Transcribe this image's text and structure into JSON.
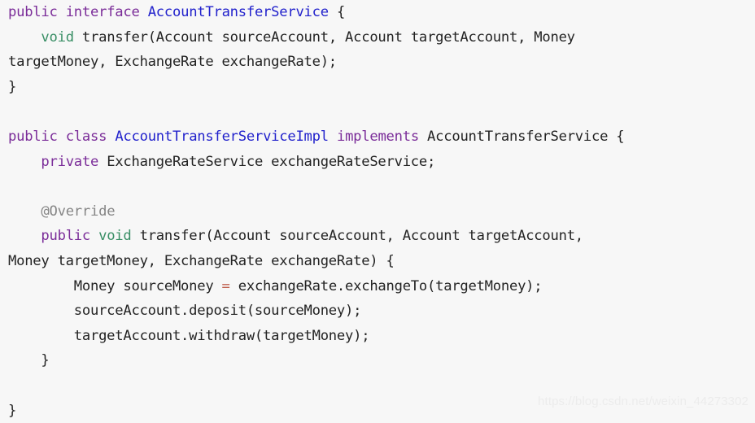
{
  "document": {
    "kind": "java-source-snippet",
    "language": "Java",
    "background_color": "#f7f7f7",
    "default_text_color": "#232323"
  },
  "theme": {
    "keyword_color": "#7b2d99",
    "type_color": "#2222cc",
    "primitive_color": "#3a8f66",
    "annotation_color": "#868686",
    "operator_color": "#c0604f",
    "plain_color": "#232323",
    "watermark_color": "#ececec"
  },
  "code": {
    "lines": [
      {
        "index": 0,
        "tokens": [
          {
            "text": "public",
            "kind": "keyword"
          },
          {
            "text": " ",
            "kind": "plain"
          },
          {
            "text": "interface",
            "kind": "keyword"
          },
          {
            "text": " ",
            "kind": "plain"
          },
          {
            "text": "AccountTransferService",
            "kind": "type"
          },
          {
            "text": " {",
            "kind": "plain"
          }
        ]
      },
      {
        "index": 1,
        "tokens": [
          {
            "text": "    ",
            "kind": "plain"
          },
          {
            "text": "void",
            "kind": "primitive"
          },
          {
            "text": " transfer(Account sourceAccount, Account targetAccount, Money",
            "kind": "plain"
          }
        ]
      },
      {
        "index": 2,
        "tokens": [
          {
            "text": "targetMoney, ExchangeRate exchangeRate);",
            "kind": "plain"
          }
        ]
      },
      {
        "index": 3,
        "tokens": [
          {
            "text": "}",
            "kind": "plain"
          }
        ]
      },
      {
        "index": 4,
        "tokens": [
          {
            "text": " ",
            "kind": "plain"
          }
        ]
      },
      {
        "index": 5,
        "tokens": [
          {
            "text": "public",
            "kind": "keyword"
          },
          {
            "text": " ",
            "kind": "plain"
          },
          {
            "text": "class",
            "kind": "keyword"
          },
          {
            "text": " ",
            "kind": "plain"
          },
          {
            "text": "AccountTransferServiceImpl",
            "kind": "type"
          },
          {
            "text": " ",
            "kind": "plain"
          },
          {
            "text": "implements",
            "kind": "keyword"
          },
          {
            "text": " AccountTransferService {",
            "kind": "plain"
          }
        ]
      },
      {
        "index": 6,
        "tokens": [
          {
            "text": "    ",
            "kind": "plain"
          },
          {
            "text": "private",
            "kind": "keyword"
          },
          {
            "text": " ExchangeRateService exchangeRateService;",
            "kind": "plain"
          }
        ]
      },
      {
        "index": 7,
        "tokens": [
          {
            "text": " ",
            "kind": "plain"
          }
        ]
      },
      {
        "index": 8,
        "tokens": [
          {
            "text": "    ",
            "kind": "plain"
          },
          {
            "text": "@Override",
            "kind": "annotation"
          }
        ]
      },
      {
        "index": 9,
        "tokens": [
          {
            "text": "    ",
            "kind": "plain"
          },
          {
            "text": "public",
            "kind": "keyword"
          },
          {
            "text": " ",
            "kind": "plain"
          },
          {
            "text": "void",
            "kind": "primitive"
          },
          {
            "text": " transfer(Account sourceAccount, Account targetAccount,",
            "kind": "plain"
          }
        ]
      },
      {
        "index": 10,
        "tokens": [
          {
            "text": "Money targetMoney, ExchangeRate exchangeRate) {",
            "kind": "plain"
          }
        ]
      },
      {
        "index": 11,
        "tokens": [
          {
            "text": "        Money sourceMoney ",
            "kind": "plain"
          },
          {
            "text": "=",
            "kind": "operator"
          },
          {
            "text": " exchangeRate.exchangeTo(targetMoney);",
            "kind": "plain"
          }
        ]
      },
      {
        "index": 12,
        "tokens": [
          {
            "text": "        sourceAccount.deposit(sourceMoney);",
            "kind": "plain"
          }
        ]
      },
      {
        "index": 13,
        "tokens": [
          {
            "text": "        targetAccount.withdraw(targetMoney);",
            "kind": "plain"
          }
        ]
      },
      {
        "index": 14,
        "tokens": [
          {
            "text": "    }",
            "kind": "plain"
          }
        ]
      },
      {
        "index": 15,
        "tokens": [
          {
            "text": " ",
            "kind": "plain"
          }
        ]
      },
      {
        "index": 16,
        "tokens": [
          {
            "text": "}",
            "kind": "plain"
          }
        ]
      }
    ]
  },
  "watermark": {
    "text": "https://blog.csdn.net/weixin_44273302"
  }
}
